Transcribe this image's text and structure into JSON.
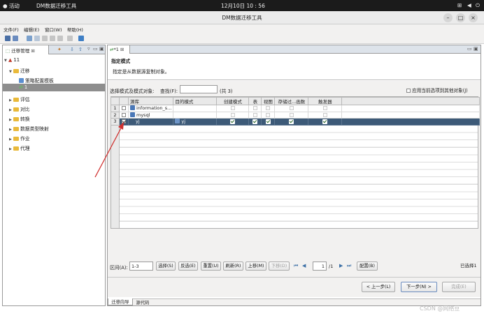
{
  "system_bar": {
    "activities": "活动",
    "app": "DM数据迁移工具",
    "clock": "12月10日  10 : 56"
  },
  "window": {
    "title": "DM数据迁移工具"
  },
  "menu": [
    "文件(F)",
    "编辑(E)",
    "窗口(W)",
    "帮助(H)"
  ],
  "left_panel": {
    "tab_label": "迁移管理",
    "tree": {
      "root": "11",
      "migrate": "迁移",
      "strategy_template": "策略配置模板",
      "selected_item": "1",
      "evaluate": "评估",
      "compare": "对比",
      "convert": "转换",
      "type_mapping": "数据类型映射",
      "job": "作业",
      "agent": "代理"
    }
  },
  "editor": {
    "tab_label": "*1",
    "header_title": "指定模式",
    "header_desc": "指定是从数据源复制对象。",
    "select_label": "选择模式及模式对象:",
    "find_label": "查找(F):",
    "find_value": "",
    "count": "(共 3)",
    "apply_label": "应用当前选项到其他对象(J)",
    "columns": [
      "源库",
      "目的模式",
      "创建模式",
      "表",
      "视图",
      "存储过...函数",
      "触发器"
    ],
    "rows": [
      {
        "n": "1",
        "checked": false,
        "source": "information_s...",
        "target": ""
      },
      {
        "n": "2",
        "checked": false,
        "source": "mysql",
        "target": ""
      },
      {
        "n": "3",
        "checked": true,
        "source": "yj",
        "target": "yj"
      }
    ],
    "range_label": "区间(A):",
    "range_value": "1-3",
    "buttons": {
      "select": "选择(S)",
      "invert": "反选(E)",
      "reset": "重置(U)",
      "refresh": "刷新(R)",
      "up": "上移(M)",
      "down": "下移(D)",
      "config": "配置(B)"
    },
    "page_value": "1",
    "page_total": "/1",
    "selected_count": "已选择1",
    "nav": {
      "prev": "< 上一步(L)",
      "next": "下一步(N) >",
      "finish": "完成(E)"
    },
    "bottom_tabs": [
      "迁移向导",
      "源代码"
    ]
  },
  "watermark": "CSDN @网络豆",
  "colors": {
    "selection": "#3d5a78",
    "annotation_arrow": "#d0302f",
    "folder": "#e9b93a"
  }
}
